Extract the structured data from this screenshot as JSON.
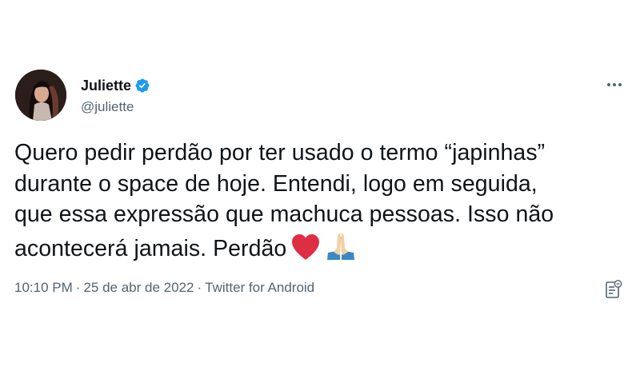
{
  "author": {
    "display_name": "Juliette",
    "handle": "@juliette",
    "verified": true
  },
  "tweet": {
    "lines": [
      "Quero pedir perdão por ter usado o termo “japinhas”",
      "durante o space de hoje. Entendi, logo em seguida,",
      "que essa expressão que machuca pessoas. Isso não",
      "acontecerá jamais. Perdão"
    ],
    "emojis": [
      "red-heart",
      "folded-hands"
    ]
  },
  "meta": {
    "time": "10:10 PM",
    "separator": "·",
    "date": "25 de abr de 2022",
    "source": "Twitter for Android"
  },
  "colors": {
    "text": "#0f1419",
    "secondary": "#536471",
    "verified": "#1d9bf0",
    "heart": "#dd2e44"
  },
  "icons": {
    "more": "more-horizontal-icon",
    "verified": "verified-badge-icon",
    "notes": "notes-icon"
  }
}
